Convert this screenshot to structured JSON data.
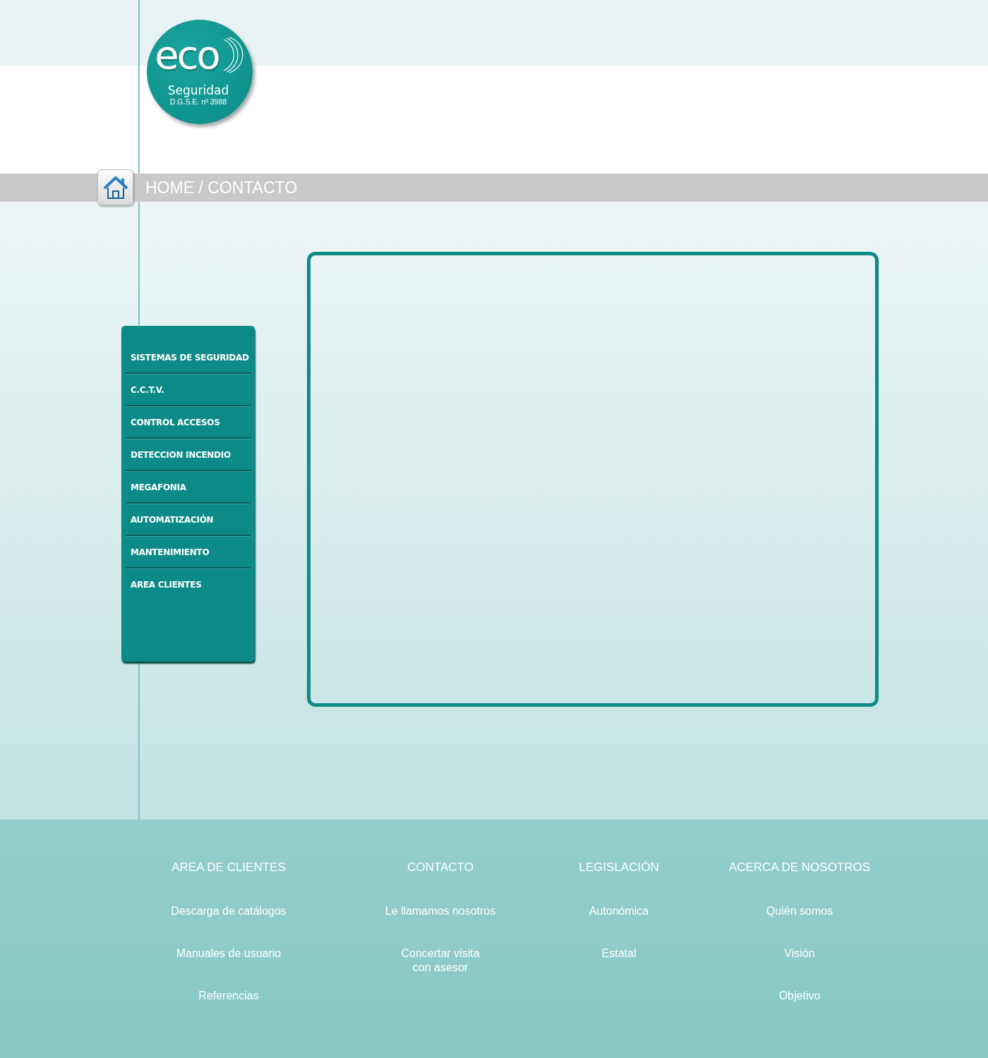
{
  "logo": {
    "wordmark": "eco",
    "tagline": "Seguridad",
    "registration": "D.G.S.E. nº 3988"
  },
  "breadcrumb": "HOME / CONTACTO",
  "nav": [
    "SISTEMAS DE SEGURIDAD",
    "C.C.T.V.",
    "CONTROL ACCESOS",
    "DETECCION INCENDIO",
    "MEGAFONIA",
    "AUTOMATIZACIÓN",
    "MANTENIMIENTO",
    "AREA CLIENTES"
  ],
  "footer": [
    {
      "heading": "AREA DE CLIENTES",
      "links": [
        "Descarga de catálogos",
        "Manuales de usuario",
        "Referencias"
      ]
    },
    {
      "heading": "CONTACTO",
      "links": [
        "Le llamamos nosotros",
        "Concertar visita\ncon asesor"
      ]
    },
    {
      "heading": "LEGISLACIÓN",
      "links": [
        "Autonómica",
        "Estatal"
      ]
    },
    {
      "heading": "ACERCA DE NOSOTROS",
      "links": [
        "Quién somos",
        "Visión",
        "Objetivo"
      ]
    }
  ]
}
